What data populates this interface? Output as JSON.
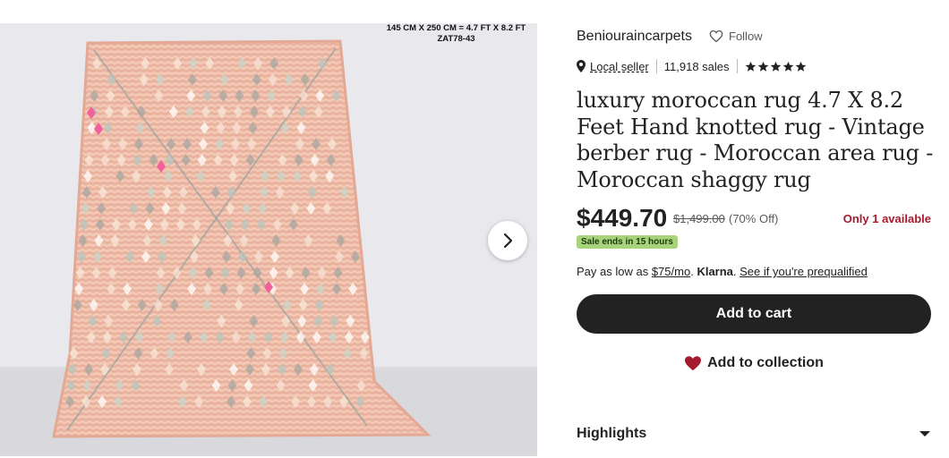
{
  "image": {
    "dimension_caption_line1": "145 CM X 250 CM = 4.7 FT X 8.2 FT",
    "dimension_caption_line2": "ZAT78-43",
    "next_icon": "chevron-right-icon"
  },
  "shop": {
    "name": "Beniouraincarpets",
    "follow_label": "Follow",
    "follow_icon": "heart-outline-icon"
  },
  "meta": {
    "location_icon": "map-pin-icon",
    "local_seller": "Local seller",
    "sales": "11,918 sales",
    "rating_stars": 5
  },
  "product": {
    "title": "luxury moroccan rug 4.7 X 8.2 Feet Hand knotted rug - Vintage berber rug - Moroccan area rug - Moroccan shaggy rug"
  },
  "pricing": {
    "price": "$449.70",
    "original_price": "$1,499.00",
    "discount": "(70% Off)",
    "availability": "Only 1 available",
    "sale_badge": "Sale ends in 15 hours"
  },
  "klarna": {
    "prefix": "Pay as low as ",
    "amount": "$75/mo",
    "dot1": ". ",
    "brand": "Klarna",
    "dot2": ". ",
    "link": "See if you're prequalified"
  },
  "actions": {
    "add_to_cart": "Add to cart",
    "add_to_collection": "Add to collection",
    "collection_icon": "heart-filled-icon"
  },
  "sections": {
    "highlights": "Highlights",
    "highlights_icon": "chevron-down-icon"
  },
  "colors": {
    "cart_button": "#222222",
    "availability": "#a61a2e",
    "sale_badge": "#a7d37a",
    "collection_heart": "#a61a2e",
    "rug_base": "#eeb9a4"
  }
}
